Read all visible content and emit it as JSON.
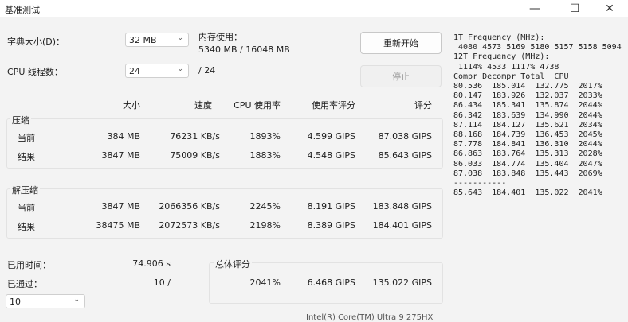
{
  "window": {
    "title": "基准测试",
    "minimize": "—",
    "maximize": "☐",
    "close": "✕"
  },
  "settings": {
    "dict_label": "字典大小(D)：",
    "dict_value": "32 MB",
    "memory_label": "内存使用：",
    "memory_value": "5340 MB / 16048 MB",
    "threads_label": "CPU 线程数：",
    "threads_value": "24",
    "threads_total": "/ 24"
  },
  "buttons": {
    "restart": "重新开始",
    "stop": "停止"
  },
  "table": {
    "headers": [
      "大小",
      "速度",
      "CPU 使用率",
      "使用率评分",
      "评分"
    ],
    "compress": {
      "label": "压缩",
      "rows": [
        {
          "name": "当前",
          "cells": [
            "384 MB",
            "76231 KB/s",
            "1893%",
            "4.599 GIPS",
            "87.038 GIPS"
          ]
        },
        {
          "name": "结果",
          "cells": [
            "3847 MB",
            "75009 KB/s",
            "1883%",
            "4.548 GIPS",
            "85.643 GIPS"
          ]
        }
      ]
    },
    "decompress": {
      "label": "解压缩",
      "rows": [
        {
          "name": "当前",
          "cells": [
            "3847 MB",
            "2066356 KB/s",
            "2245%",
            "8.191 GIPS",
            "183.848 GIPS"
          ]
        },
        {
          "name": "结果",
          "cells": [
            "38475 MB",
            "2072573 KB/s",
            "2198%",
            "8.389 GIPS",
            "184.401 GIPS"
          ]
        }
      ]
    }
  },
  "footer": {
    "elapsed_label": "已用时间：",
    "elapsed_value": "74.906 s",
    "passed_label": "已通过：",
    "passed_value": "10 /",
    "passes_select": "10",
    "total_label": "总体评分",
    "total_cells": [
      "2041%",
      "6.468 GIPS",
      "135.022 GIPS"
    ],
    "cut_text": "Intel(R) Core(TM) Ultra 9 275HX"
  },
  "log": {
    "lines": [
      "1T Frequency (MHz):",
      " 4080 4573 5169 5180 5157 5158 5094",
      "12T Frequency (MHz):",
      " 1114% 4533 1117% 4738",
      "Compr Decompr Total  CPU",
      "80.536  185.014  132.775  2017%",
      "80.147  183.926  132.037  2033%",
      "86.434  185.341  135.874  2044%",
      "86.342  183.639  134.990  2044%",
      "87.114  184.127  135.621  2034%",
      "88.168  184.739  136.453  2045%",
      "87.778  184.841  136.310  2044%",
      "86.863  183.764  135.313  2028%",
      "86.033  184.774  135.404  2047%",
      "87.038  183.848  135.443  2069%",
      "-----------",
      "85.643  184.401  135.022  2041%"
    ]
  }
}
